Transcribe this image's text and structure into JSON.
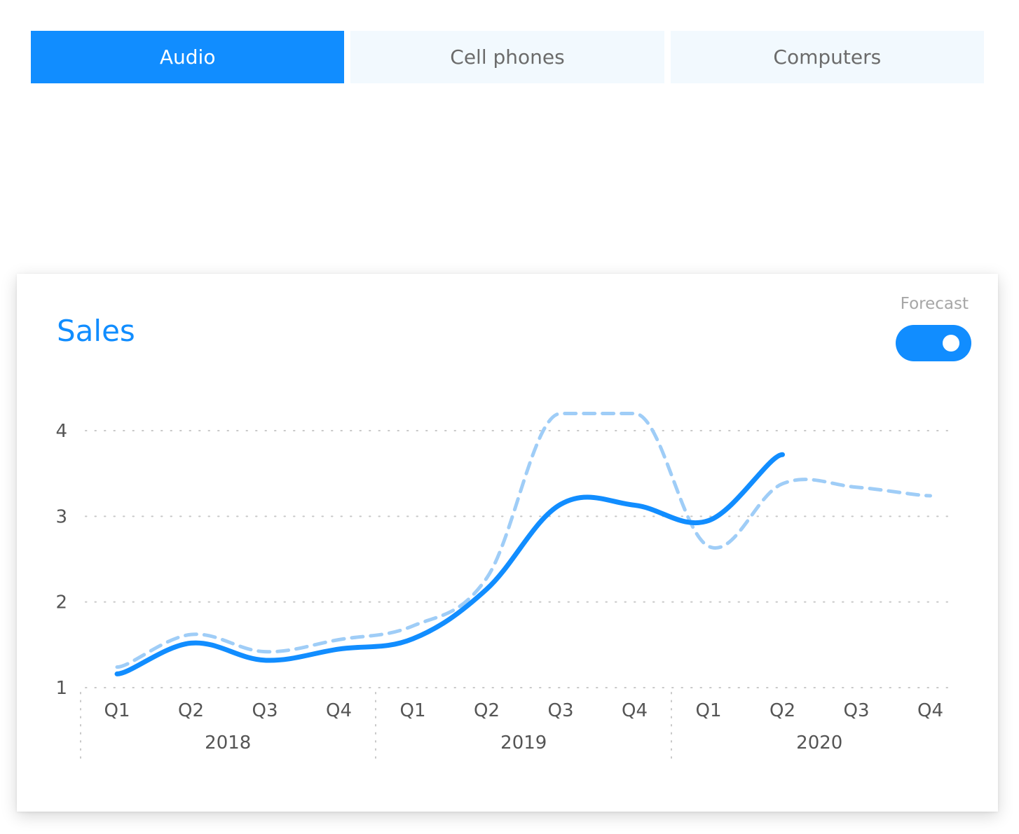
{
  "tabs": [
    {
      "label": "Audio",
      "active": true
    },
    {
      "label": "Cell phones",
      "active": false
    },
    {
      "label": "Computers",
      "active": false
    }
  ],
  "card": {
    "title": "Sales",
    "forecast_label": "Forecast",
    "forecast_on": true
  },
  "colors": {
    "accent": "#118dff",
    "forecast": "#9fcdf7",
    "tab_inactive_bg": "#f2f9fe",
    "tab_inactive_text": "#6b6b6b"
  },
  "chart_data": {
    "type": "line",
    "title": "Sales",
    "quarters": [
      "Q1",
      "Q2",
      "Q3",
      "Q4",
      "Q1",
      "Q2",
      "Q3",
      "Q4",
      "Q1",
      "Q2",
      "Q3",
      "Q4"
    ],
    "years": [
      "2018",
      "2019",
      "2020"
    ],
    "ylim": [
      1,
      4
    ],
    "yticks": [
      "1",
      "2",
      "3",
      "4"
    ],
    "grid": "dotted horizontal",
    "series": [
      {
        "key": "actual",
        "style": "solid",
        "values": [
          1.16,
          1.52,
          1.32,
          1.45,
          1.57,
          2.15,
          3.14,
          3.13,
          2.95,
          3.72,
          null,
          null
        ]
      },
      {
        "key": "forecast",
        "style": "dashed",
        "values": [
          1.24,
          1.62,
          1.42,
          1.56,
          1.72,
          2.28,
          4.2,
          4.2,
          2.65,
          3.38,
          3.34,
          3.24
        ]
      }
    ]
  }
}
